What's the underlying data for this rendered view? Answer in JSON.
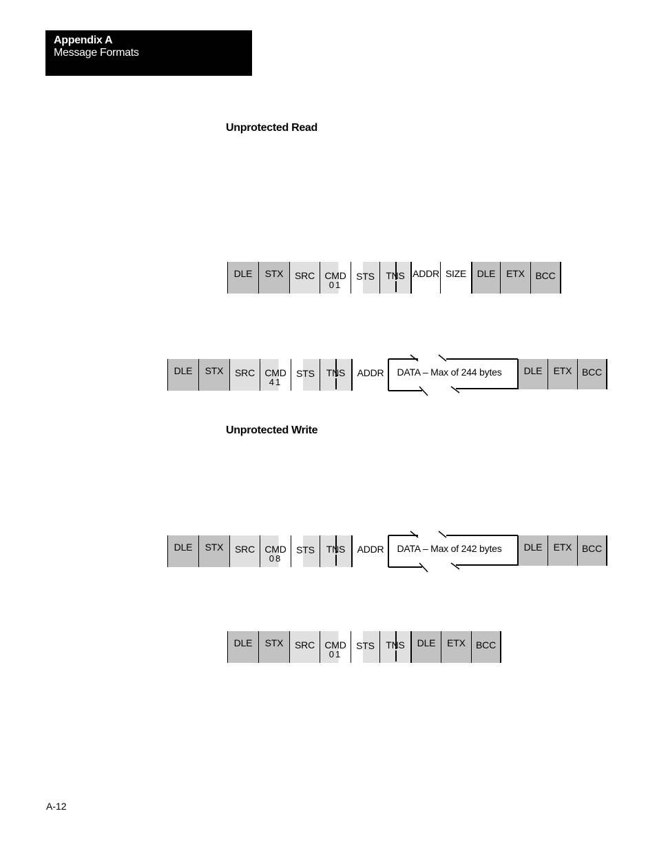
{
  "header": {
    "title": "Appendix A",
    "subtitle": "Message Formats"
  },
  "sections": [
    {
      "title": "Unprotected Read"
    },
    {
      "title": "Unprotected Write"
    }
  ],
  "frames": {
    "read_command": {
      "cells": [
        "DLE",
        "STX",
        "SRC",
        "CMD",
        "STS",
        "TNS",
        "ADDR",
        "SIZE",
        "DLE",
        "ETX",
        "BCC"
      ],
      "cmd_code": "01"
    },
    "read_reply": {
      "cells": [
        "DLE",
        "STX",
        "SRC",
        "CMD",
        "STS",
        "TNS",
        "ADDR"
      ],
      "cmd_code": "41",
      "data_label": "DATA – Max of 244 bytes",
      "tail": [
        "DLE",
        "ETX",
        "BCC"
      ]
    },
    "write_command": {
      "cells": [
        "DLE",
        "STX",
        "SRC",
        "CMD",
        "STS",
        "TNS",
        "ADDR"
      ],
      "cmd_code": "08",
      "data_label": "DATA – Max of 242 bytes",
      "tail": [
        "DLE",
        "ETX",
        "BCC"
      ]
    },
    "write_reply": {
      "cells": [
        "DLE",
        "STX",
        "SRC",
        "CMD",
        "STS",
        "TNS",
        "DLE",
        "ETX",
        "BCC"
      ],
      "cmd_code": "01"
    }
  },
  "footer": {
    "page_number": "A-12"
  }
}
